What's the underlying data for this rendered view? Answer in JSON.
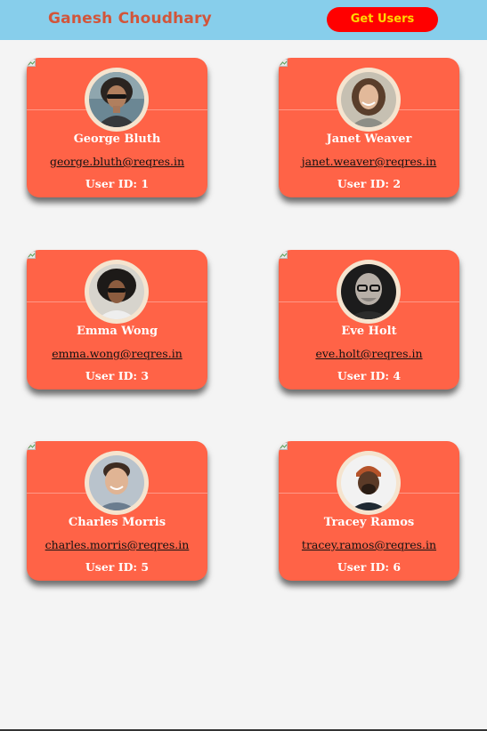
{
  "header": {
    "brand": "Ganesh Choudhary",
    "get_users_label": "Get Users",
    "colors": {
      "bar": "#87ceeb",
      "brand_text": "#d2553a",
      "button_bg": "#ff0000",
      "button_text": "#ffd700"
    }
  },
  "cards_style": {
    "background": "#ff6347",
    "ring": "#f5e4cf",
    "id_prefix": "User ID:"
  },
  "users": [
    {
      "name": "George Bluth",
      "email": "george.bluth@reqres.in",
      "id_label": "User ID: 1"
    },
    {
      "name": "Janet Weaver",
      "email": "janet.weaver@reqres.in",
      "id_label": "User ID: 2"
    },
    {
      "name": "Emma Wong",
      "email": "emma.wong@reqres.in",
      "id_label": "User ID: 3"
    },
    {
      "name": "Eve Holt",
      "email": "eve.holt@reqres.in",
      "id_label": "User ID: 4"
    },
    {
      "name": "Charles Morris",
      "email": "charles.morris@reqres.in",
      "id_label": "User ID: 5"
    },
    {
      "name": "Tracey Ramos",
      "email": "tracey.ramos@reqres.in",
      "id_label": "User ID: 6"
    }
  ]
}
